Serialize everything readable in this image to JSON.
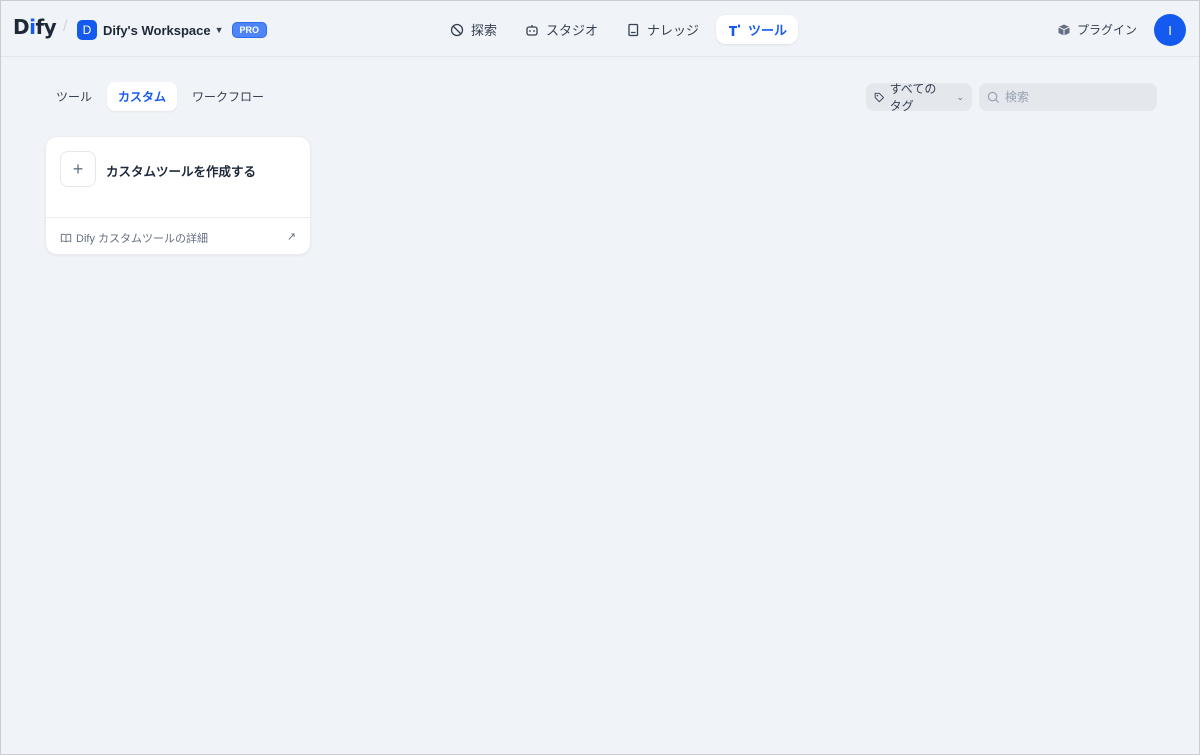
{
  "app": {
    "logo_prefix": "D",
    "logo_i": "i",
    "logo_suffix": "fy",
    "workspace_initial": "D",
    "workspace_name": "Dify's Workspace",
    "plan_badge": "PRO",
    "user_initial": "I",
    "brand_color": "#155aef"
  },
  "nav": {
    "items": [
      {
        "label": "探索",
        "icon": "compass-icon"
      },
      {
        "label": "スタジオ",
        "icon": "robot-icon"
      },
      {
        "label": "ナレッジ",
        "icon": "book-icon"
      },
      {
        "label": "ツール",
        "icon": "tool-icon",
        "active": true
      }
    ],
    "plugin_label": "プラグイン"
  },
  "tabs": {
    "items": [
      {
        "label": "ツール"
      },
      {
        "label": "カスタム",
        "active": true
      },
      {
        "label": "ワークフロー"
      }
    ]
  },
  "filters": {
    "tag_label": "すべてのタグ",
    "search_placeholder": "検索"
  },
  "card": {
    "create_label": "カスタムツールを作成する",
    "link_label": "Dify カスタムツールの詳細"
  }
}
